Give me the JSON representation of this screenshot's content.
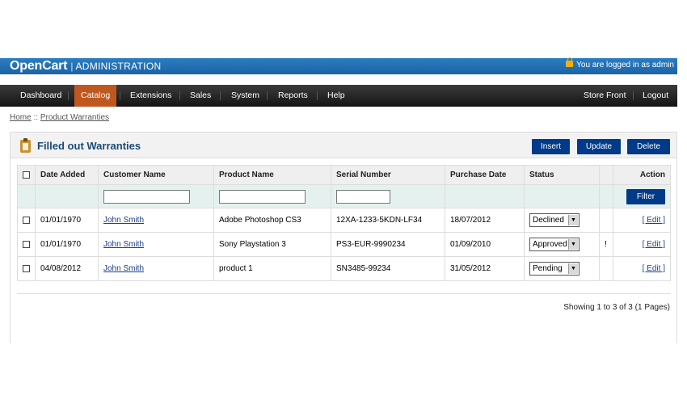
{
  "header": {
    "brand": "OpenCart",
    "separator": "|",
    "section": "ADMINISTRATION",
    "login_text": "You are logged in as admin"
  },
  "menu": {
    "items": [
      "Dashboard",
      "Catalog",
      "Extensions",
      "Sales",
      "System",
      "Reports",
      "Help"
    ],
    "active": "Catalog",
    "store_front": "Store Front",
    "logout": "Logout"
  },
  "breadcrumb": {
    "home": "Home",
    "separator": "::",
    "current": "Product Warranties"
  },
  "box": {
    "title": "Filled out Warranties",
    "buttons": {
      "insert": "Insert",
      "update": "Update",
      "delete": "Delete"
    }
  },
  "table": {
    "columns": [
      "Date Added",
      "Customer Name",
      "Product Name",
      "Serial Number",
      "Purchase Date",
      "Status",
      "",
      "Action"
    ],
    "filter_button": "Filter",
    "rows": [
      {
        "date_added": "01/01/1970",
        "customer": "John Smith",
        "product": "Adobe Photoshop CS3",
        "serial": "12XA-1233-5KDN-LF34",
        "purchase_date": "18/07/2012",
        "status": "Declined",
        "flag": "",
        "action": "[ Edit ]"
      },
      {
        "date_added": "01/01/1970",
        "customer": "John Smith",
        "product": "Sony Playstation 3",
        "serial": "PS3-EUR-9990234",
        "purchase_date": "01/09/2010",
        "status": "Approved",
        "flag": "!",
        "action": "[ Edit ]"
      },
      {
        "date_added": "04/08/2012",
        "customer": "John Smith",
        "product": "product 1",
        "serial": "SN3485-99234",
        "purchase_date": "31/05/2012",
        "status": "Pending",
        "flag": "",
        "action": "[ Edit ]"
      }
    ]
  },
  "pagination": "Showing 1 to 3 of 3 (1 Pages)",
  "colors": {
    "header_blue": "#1c64a6",
    "menu_dark": "#1b1b1b",
    "active_tab": "#c0571f",
    "button_blue": "#003a88",
    "title_blue": "#1a4a78",
    "filter_row": "#e4f1ef"
  }
}
